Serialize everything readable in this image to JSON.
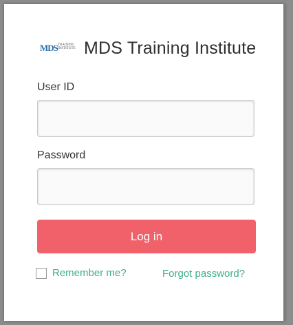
{
  "header": {
    "logo_text": "MDS",
    "logo_subtext": "TRAINING INSTITUTE",
    "title": "MDS Training Institute"
  },
  "form": {
    "userid_label": "User ID",
    "userid_value": "",
    "password_label": "Password",
    "password_value": "",
    "login_label": "Log in",
    "remember_label": "Remember me?",
    "remember_checked": false,
    "forgot_label": "Forgot password?"
  },
  "colors": {
    "accent": "#f0616a",
    "link": "#3fae8c",
    "logo": "#2a6fb0"
  },
  "icons": {
    "logo": "mds-logo-icon",
    "checkbox": "checkbox-icon"
  }
}
